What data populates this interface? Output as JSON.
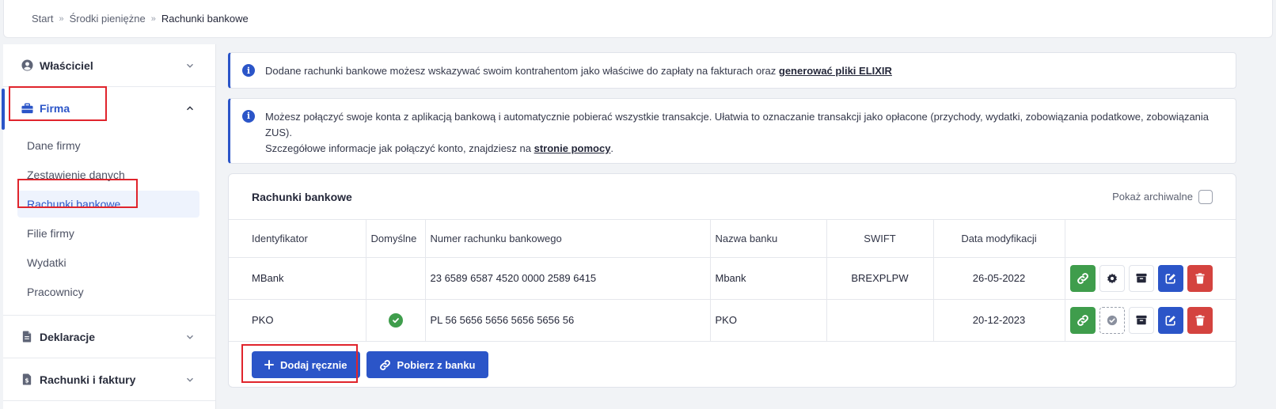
{
  "breadcrumb": {
    "items": [
      "Start",
      "Środki pieniężne"
    ],
    "current": "Rachunki bankowe"
  },
  "sidebar": {
    "owner": {
      "label": "Właściciel",
      "icon": "user-circle-icon"
    },
    "company": {
      "label": "Firma",
      "icon": "briefcase-icon",
      "items": [
        {
          "label": "Dane firmy"
        },
        {
          "label": "Zestawienie danych"
        },
        {
          "label": "Rachunki bankowe"
        },
        {
          "label": "Filie firmy"
        },
        {
          "label": "Wydatki"
        },
        {
          "label": "Pracownicy"
        }
      ]
    },
    "declarations": {
      "label": "Deklaracje",
      "icon": "document-icon"
    },
    "invoices": {
      "label": "Rachunki i faktury",
      "icon": "invoice-icon"
    }
  },
  "alerts": {
    "elixir": {
      "text": "Dodane rachunki bankowe możesz wskazywać swoim kontrahentom jako właściwe do zapłaty na fakturach oraz ",
      "link": "generować pliki ELIXIR"
    },
    "connect": {
      "line1": "Możesz połączyć swoje konta z aplikacją bankową i automatycznie pobierać wszystkie transakcje. Ułatwia to oznaczanie transakcji jako opłacone (przychody, wydatki, zobowiązania podatkowe, zobowiązania ZUS).",
      "line2": "Szczegółowe informacje jak połączyć konto, znajdziesz na ",
      "link": "stronie pomocy",
      "end": "."
    }
  },
  "accounts": {
    "title": "Rachunki bankowe",
    "show_archived": "Pokaż archiwalne",
    "columns": {
      "id": "Identyfikator",
      "default": "Domyślne",
      "number": "Numer rachunku bankowego",
      "bank": "Nazwa banku",
      "swift": "SWIFT",
      "modified": "Data modyfikacji"
    },
    "rows": [
      {
        "id": "MBank",
        "is_default": false,
        "number": "23 6589 6587 4520 0000 2589 6415",
        "bank": "Mbank",
        "swift": "BREXPLPW",
        "modified": "26-05-2022"
      },
      {
        "id": "PKO",
        "is_default": true,
        "number": "PL 56 5656 5656 5656 5656 56",
        "bank": "PKO",
        "swift": "",
        "modified": "20-12-2023"
      }
    ],
    "add_manual": "Dodaj ręcznie",
    "fetch_bank": "Pobierz z banku"
  },
  "colors": {
    "primary": "#2b55c8",
    "success": "#3f9d4c",
    "danger": "#d4433f",
    "highlight": "#e0242c"
  }
}
